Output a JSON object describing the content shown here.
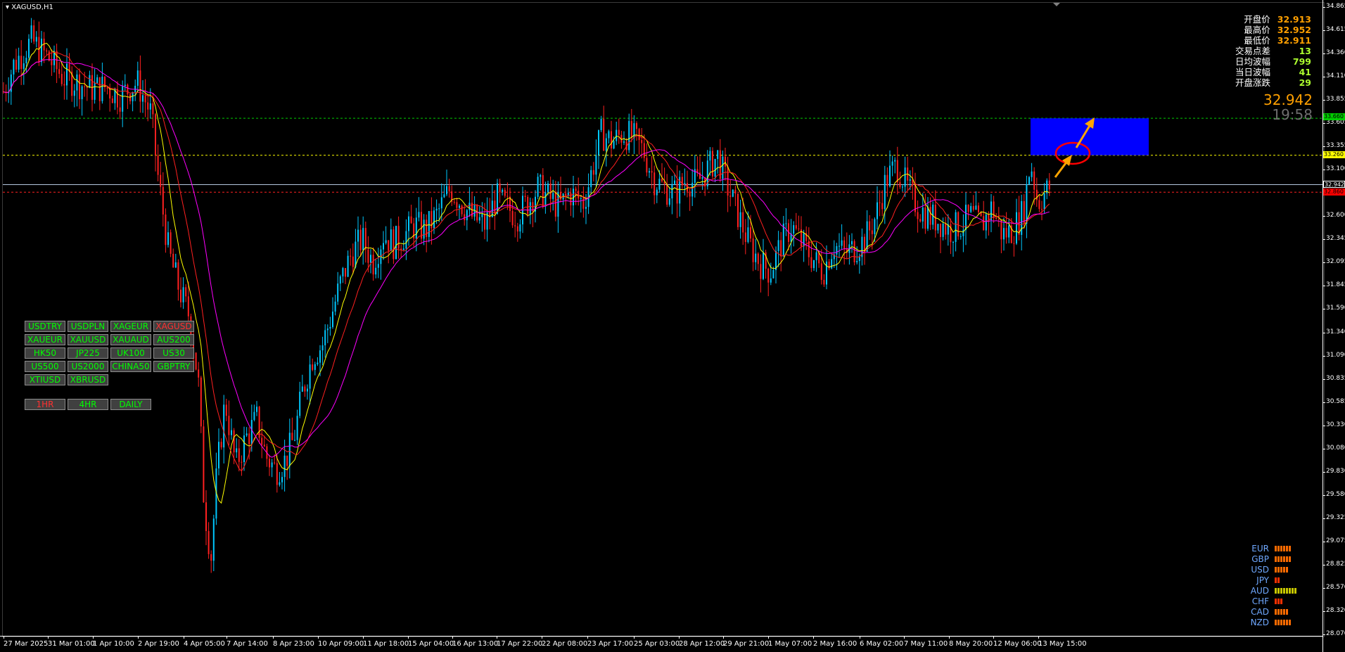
{
  "chart": {
    "symbol_title": "XAGUSD,H1",
    "price_ticks": [
      "34.865",
      "34.615",
      "34.360",
      "34.110",
      "33.855",
      "33.605",
      "33.355",
      "33.100",
      "32.845",
      "32.600",
      "32.345",
      "32.095",
      "31.845",
      "31.590",
      "31.340",
      "31.090",
      "30.835",
      "30.585",
      "30.330",
      "30.080",
      "29.830",
      "29.580",
      "29.325",
      "29.075",
      "28.825",
      "28.570",
      "28.320",
      "28.070"
    ],
    "time_ticks": [
      "27 Mar 2025",
      "31 Mar 01:00",
      "1 Apr 10:00",
      "2 Apr 19:00",
      "4 Apr 05:00",
      "7 Apr 14:00",
      "8 Apr 23:00",
      "10 Apr 09:00",
      "11 Apr 18:00",
      "15 Apr 04:00",
      "16 Apr 13:00",
      "17 Apr 22:00",
      "22 Apr 08:00",
      "23 Apr 17:00",
      "25 Apr 03:00",
      "28 Apr 12:00",
      "29 Apr 21:00",
      "1 May 07:00",
      "2 May 16:00",
      "6 May 02:00",
      "7 May 11:00",
      "8 May 20:00",
      "12 May 06:00",
      "13 May 15:00"
    ],
    "level_tags": {
      "green": "33.660",
      "yellow": "33.260",
      "bid": "32.942",
      "red": "32.860"
    },
    "colors": {
      "bull_candle": "#00c8ff",
      "bear_candle": "#ff2020",
      "ma_fast": "#ffff00",
      "ma_mid": "#ff2020",
      "ma_slow": "#ff00ff",
      "zone": "#0000ff",
      "arrow": "#ffa500",
      "circle": "#ff0000"
    }
  },
  "info": {
    "rows": [
      {
        "label": "开盘价",
        "value": "32.913",
        "color": "#ffa000"
      },
      {
        "label": "最高价",
        "value": "32.952",
        "color": "#ffa000"
      },
      {
        "label": "最低价",
        "value": "32.911",
        "color": "#ffa000"
      },
      {
        "label": "交易点差",
        "value": "13",
        "color": "#adff2f"
      },
      {
        "label": "日均波幅",
        "value": "799",
        "color": "#adff2f"
      },
      {
        "label": "当日波幅",
        "value": "41",
        "color": "#adff2f"
      },
      {
        "label": "开盘涨跌",
        "value": "29",
        "color": "#adff2f"
      }
    ],
    "bid": "32.942",
    "timer": "19:58"
  },
  "symbol_buttons": [
    "USDTRY",
    "USDPLN",
    "XAGEUR",
    "XAGUSD",
    "XAUEUR",
    "XAUUSD",
    "XAUAUD",
    "AUS200",
    "HK50",
    "JP225",
    "UK100",
    "US30",
    "US500",
    "US2000",
    "CHINA50",
    "GBPTRY",
    "XTIUSD",
    "XBRUSD"
  ],
  "active_symbol": "XAGUSD",
  "timeframe_buttons": [
    "1HR",
    "4HR",
    "DAILY"
  ],
  "active_timeframe": "1HR",
  "currency_strength": [
    {
      "name": "EUR",
      "level": 6,
      "color": "#ff6a00"
    },
    {
      "name": "GBP",
      "level": 6,
      "color": "#ff6a00"
    },
    {
      "name": "USD",
      "level": 5,
      "color": "#ff6a00"
    },
    {
      "name": "JPY",
      "level": 2,
      "color": "#ff3000"
    },
    {
      "name": "AUD",
      "level": 8,
      "color": "#c8c800"
    },
    {
      "name": "CHF",
      "level": 3,
      "color": "#ff3000"
    },
    {
      "name": "CAD",
      "level": 5,
      "color": "#ff6a00"
    },
    {
      "name": "NZD",
      "level": 6,
      "color": "#ff6a00"
    }
  ]
}
